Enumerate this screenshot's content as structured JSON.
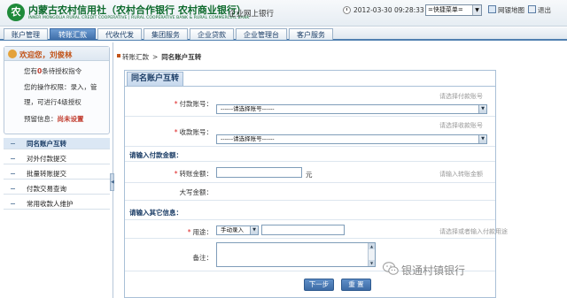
{
  "header": {
    "logo_char": "农",
    "bank_title": "内蒙古农村信用社（农村合作银行 农村商业银行）",
    "bank_subtitle": "INNER MONGOLIA RURAL CREDIT COOPERATIVE | RURAL COOPERATIVE BANK & RURAL COMMERCIAL BANK",
    "service_name": "企业网上银行",
    "datetime": "2012-03-30 09:28:33",
    "quick_menu": "=快捷菜单=",
    "sitemap": "网银地图",
    "exit": "退出"
  },
  "nav": {
    "tabs": [
      {
        "label": "账户管理",
        "active": false
      },
      {
        "label": "转账汇款",
        "active": true
      },
      {
        "label": "代收代发",
        "active": false
      },
      {
        "label": "集团服务",
        "active": false
      },
      {
        "label": "企业贷款",
        "active": false
      },
      {
        "label": "企业管理台",
        "active": false
      },
      {
        "label": "客户服务",
        "active": false
      }
    ]
  },
  "sidebar": {
    "welcome": "欢迎您，刘俊林",
    "pending_prefix": "您有",
    "pending_count": "0",
    "pending_suffix": "条待授权指令",
    "perm_line1": "您的操作权限：录入，管",
    "perm_line2": "理，可进行4级授权",
    "reserved_label": "预留信息：",
    "reserved_value": "尚未设置",
    "menu": [
      {
        "label": "同名账户互转",
        "active": true
      },
      {
        "label": "对外付款提交",
        "active": false
      },
      {
        "label": "批量转账提交",
        "active": false
      },
      {
        "label": "付款交易查询",
        "active": false
      },
      {
        "label": "常用收款人维护",
        "active": false
      }
    ],
    "collapse_glyph": "◀"
  },
  "breadcrumb": {
    "parent": "转账汇款",
    "separator": ">",
    "current": "同名账户互转"
  },
  "form": {
    "panel_title": "同名账户互转",
    "payer": {
      "label": "付款账号：",
      "hint": "请选择付款账号",
      "select_value": "------请选择账号------"
    },
    "payee": {
      "label": "收款账号：",
      "hint": "请选择收款账号",
      "select_value": "------请选择账号------"
    },
    "section_amount": "请输入付款金额：",
    "amount": {
      "label": "转账金额：",
      "unit": "元",
      "hint": "请输入转账金额",
      "value": ""
    },
    "uppercase": {
      "label": "大写金额：",
      "value": ""
    },
    "section_other": "请输入其它信息：",
    "purpose": {
      "label": "用途：",
      "mode": "手动录入",
      "value": "",
      "hint": "请选择或者输入付款用途"
    },
    "remark": {
      "label": "备注：",
      "value": ""
    },
    "required_mark": "*",
    "next_button": "下一步",
    "reset_button": "重 置"
  },
  "watermark": "银通村镇银行",
  "colors": {
    "accent": "#3e6ea8",
    "brand_green": "#0f6b2e",
    "welcome_orange": "#c2541a",
    "required_red": "#dd2222"
  }
}
